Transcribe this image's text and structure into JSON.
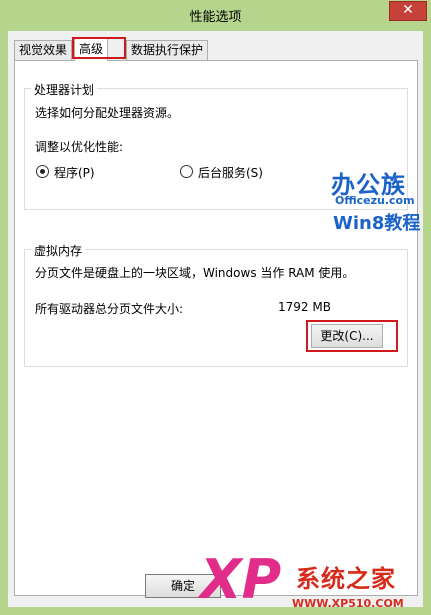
{
  "window": {
    "title": "性能选项",
    "close_glyph": "✕"
  },
  "tabs": [
    {
      "label": "视觉效果",
      "selected": false
    },
    {
      "label": "高级",
      "selected": true
    },
    {
      "label": "数据执行保护",
      "selected": false
    }
  ],
  "processor": {
    "title": "处理器计划",
    "description": "选择如何分配处理器资源。",
    "adjust_label": "调整以优化性能:",
    "options": [
      {
        "label": "程序(P)",
        "checked": true
      },
      {
        "label": "后台服务(S)",
        "checked": false
      }
    ]
  },
  "virtual_memory": {
    "title": "虚拟内存",
    "description": "分页文件是硬盘上的一块区域，Windows 当作 RAM 使用。",
    "total_label": "所有驱动器总分页文件大小:",
    "total_value": "1792 MB",
    "change_button": "更改(C)..."
  },
  "footer": {
    "ok_button": "确定"
  },
  "watermarks": {
    "logo1_name": "办公族",
    "logo1_url": "Officezu.com",
    "logo1_sub": "Win8教程",
    "logo2_mark": "XP",
    "logo2_name": "系统之家",
    "logo2_url": "WWW.XP510.COM"
  },
  "colors": {
    "highlight": "#d0191d",
    "window_frame": "#b6d58c",
    "close_button": "#c7413b"
  }
}
